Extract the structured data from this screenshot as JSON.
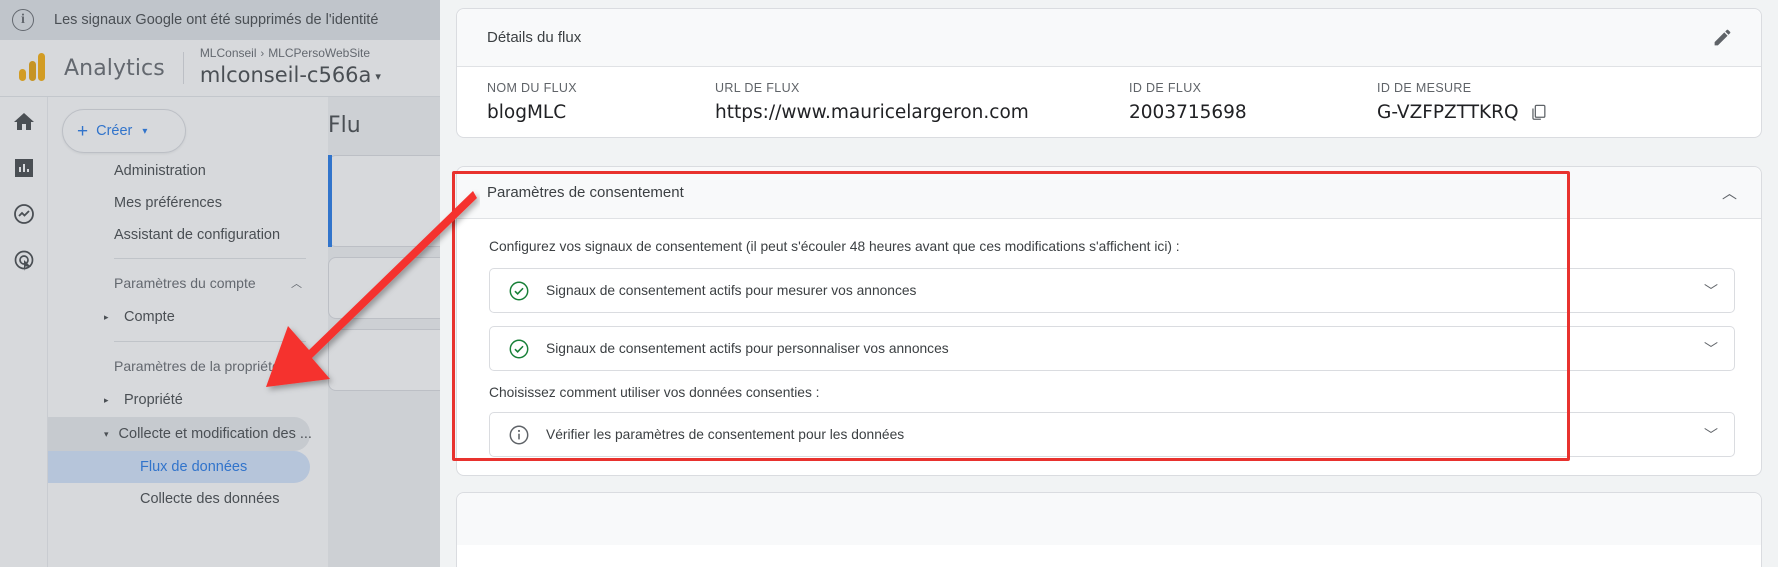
{
  "notification": {
    "icon": "info-icon",
    "text": "Les signaux Google ont été supprimés de l'identité"
  },
  "header": {
    "logo_name": "analytics-logo",
    "wordmark": "Analytics",
    "breadcrumb_account": "MLConseil",
    "breadcrumb_separator": "›",
    "breadcrumb_property": "MLCPersoWebSite",
    "property_selector": "mlconseil-c566a",
    "property_caret": "▾"
  },
  "rail": {
    "items": [
      {
        "name": "home-icon"
      },
      {
        "name": "reports-icon"
      },
      {
        "name": "explore-icon"
      },
      {
        "name": "advertising-icon"
      }
    ]
  },
  "sidebar": {
    "create_button": {
      "plus": "+",
      "label": "Créer",
      "caret": "▾"
    },
    "top_items": [
      {
        "label": "Administration"
      },
      {
        "label": "Mes préférences"
      },
      {
        "label": "Assistant de configuration"
      }
    ],
    "account_group": {
      "label": "Paramètres du compte",
      "chevron": "︿"
    },
    "account_item": {
      "label": "Compte",
      "triangle": "▸"
    },
    "property_group": {
      "label": "Paramètres de la propriété",
      "chevron": "︿"
    },
    "property_item": {
      "label": "Propriété",
      "triangle": "▸"
    },
    "collect_item": {
      "label": "Collecte et modification des ...",
      "triangle": "▾"
    },
    "leaf_items": [
      {
        "label": "Flux de données",
        "selected": true
      },
      {
        "label": "Collecte des données",
        "selected": false
      }
    ]
  },
  "content_peek": {
    "title": "Flu"
  },
  "stream_details": {
    "title": "Détails du flux",
    "edit_icon": "pencil-icon",
    "fields": [
      {
        "label": "NOM DU FLUX",
        "value": "blogMLC"
      },
      {
        "label": "URL DE FLUX",
        "value": "https://www.mauricelargeron.com"
      },
      {
        "label": "ID DE FLUX",
        "value": "2003715698"
      },
      {
        "label": "ID DE MESURE",
        "value": "G-VZFPZTTKRQ",
        "copy_icon": "copy-icon"
      }
    ]
  },
  "consent_settings": {
    "title": "Paramètres de consentement",
    "collapse_chevron": "︿",
    "description": "Configurez vos signaux de consentement (il peut s'écouler 48 heures avant que ces modifications s'affichent ici) :",
    "rows": [
      {
        "icon": "check-circle-icon",
        "icon_color": "#188038",
        "label": "Signaux de consentement actifs pour mesurer vos annonces",
        "chevron": "﹀"
      },
      {
        "icon": "check-circle-icon",
        "icon_color": "#188038",
        "label": "Signaux de consentement actifs pour personnaliser vos annonces",
        "chevron": "﹀"
      }
    ],
    "secondary_description": "Choisissez comment utiliser vos données consenties :",
    "secondary_rows": [
      {
        "icon": "info-circle-icon",
        "icon_color": "#5f6368",
        "label": "Vérifier les paramètres de consentement pour les données",
        "chevron": "﹀"
      }
    ]
  },
  "annotations": {
    "highlight_color": "#e8322e",
    "arrow_name": "red-arrow-annotation",
    "rect_name": "red-highlight-rectangle"
  },
  "colors": {
    "accent_blue": "#1a73e8",
    "selected_bg": "#d2e3fc",
    "green": "#188038",
    "panel_bg": "#f1f3f4"
  }
}
